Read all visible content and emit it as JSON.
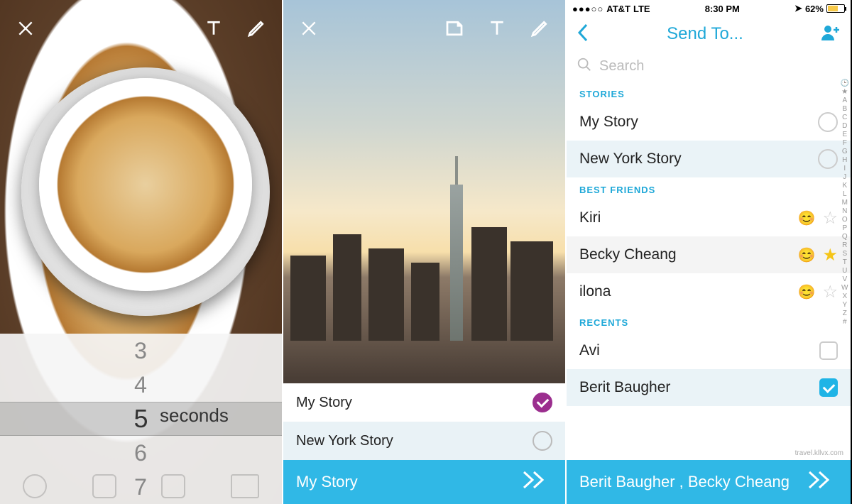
{
  "panel1": {
    "timer": {
      "values": [
        "3",
        "4",
        "5",
        "6",
        "7"
      ],
      "selected_index": 2,
      "unit_label": "seconds"
    }
  },
  "panel2": {
    "stories": [
      {
        "label": "My Story",
        "checked": true
      },
      {
        "label": "New York Story",
        "checked": false
      }
    ],
    "send_bar_text": "My Story"
  },
  "panel3": {
    "status": {
      "carrier": "AT&T",
      "network": "LTE",
      "time": "8:30 PM",
      "battery_pct": "62%"
    },
    "nav_title": "Send To...",
    "search_placeholder": "Search",
    "sections": {
      "stories_header": "STORIES",
      "stories": [
        {
          "label": "My Story",
          "selected": false
        },
        {
          "label": "New York Story",
          "selected": false,
          "highlight": true
        }
      ],
      "best_header": "BEST FRIENDS",
      "best": [
        {
          "label": "Kiri",
          "emoji": "😊",
          "starred": false
        },
        {
          "label": "Becky Cheang",
          "emoji": "😊",
          "starred": true,
          "shade": true
        },
        {
          "label": "ilona",
          "emoji": "😊",
          "starred": false
        }
      ],
      "recents_header": "RECENTS",
      "recents": [
        {
          "label": "Avi",
          "checked": false
        },
        {
          "label": "Berit Baugher",
          "checked": true,
          "highlight": true
        }
      ]
    },
    "send_bar_text": "Berit Baugher , Becky Cheang",
    "index_rail": [
      "🕒",
      "★",
      "A",
      "B",
      "C",
      "D",
      "E",
      "F",
      "G",
      "H",
      "I",
      "J",
      "K",
      "L",
      "M",
      "N",
      "O",
      "P",
      "Q",
      "R",
      "S",
      "T",
      "U",
      "V",
      "W",
      "X",
      "Y",
      "Z",
      "#"
    ],
    "watermark": "travel.kllvx.com"
  }
}
